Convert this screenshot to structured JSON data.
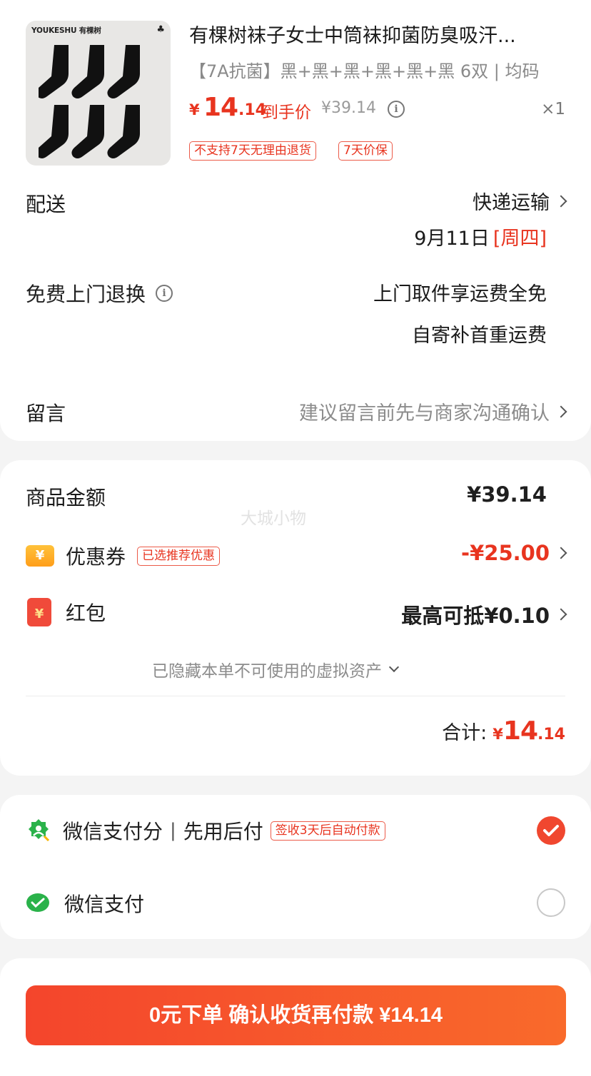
{
  "product": {
    "brand_text": "YOUKESHU 有棵树",
    "title": "有棵树袜子女士中筒袜抑菌防臭吸汗...",
    "spec": "【7A抗菌】黑+黑+黑+黑+黑+黑  6双 | 均码",
    "price_symbol": "¥",
    "price_int": "14",
    "price_dec": ".14",
    "price_label": "到手价",
    "original_price": "¥39.14",
    "quantity": "×1",
    "tags": [
      "不支持7天无理由退货",
      "7天价保"
    ]
  },
  "delivery": {
    "label": "配送",
    "method": "快递运输",
    "date": "9月11日",
    "weekday": "[周四]"
  },
  "return_service": {
    "label": "免费上门退换",
    "line1": "上门取件享运费全免",
    "line2": "自寄补首重运费"
  },
  "message": {
    "label": "留言",
    "placeholder": "建议留言前先与商家沟通确认"
  },
  "summary": {
    "goods_label": "商品金额",
    "goods_amount": "¥39.14",
    "watermark": "大城小物",
    "coupon_label": "优惠券",
    "coupon_icon": "¥",
    "coupon_tag": "已选推荐优惠",
    "coupon_amount": "-¥25.00",
    "redpacket_label": "红包",
    "redpacket_icon": "¥",
    "redpacket_value": "最高可抵¥0.10",
    "hidden_note": "已隐藏本单不可使用的虚拟资产",
    "total_label": "合计:",
    "total_symbol": "¥",
    "total_int": "14",
    "total_dec": ".14"
  },
  "payment": {
    "option1_name": "微信支付分",
    "option1_sep": "|",
    "option1_desc": "先用后付",
    "option1_tag": "签收3天后自动付款",
    "option1_selected": true,
    "option2_name": "微信支付",
    "option2_selected": false
  },
  "submit": {
    "label": "0元下单  确认收货再付款  ¥14.14"
  },
  "colors": {
    "accent_red": "#e8341f",
    "wechat_green": "#2ab24a"
  }
}
